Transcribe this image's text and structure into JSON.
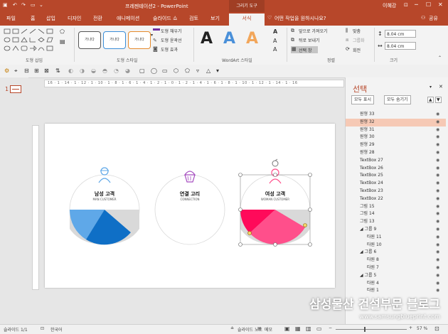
{
  "window": {
    "title": "프레젠테이션2 - PowerPoint",
    "contextual_tab_group": "그리기 도구",
    "user": "이혜강"
  },
  "tabs": [
    {
      "label": "파일"
    },
    {
      "label": "홈"
    },
    {
      "label": "삽입"
    },
    {
      "label": "디자인"
    },
    {
      "label": "전환"
    },
    {
      "label": "애니메이션"
    },
    {
      "label": "슬라이드 쇼"
    },
    {
      "label": "검토"
    },
    {
      "label": "보기"
    },
    {
      "label": "서식"
    }
  ],
  "tellme": {
    "placeholder": "어떤 작업을 원하시나요?"
  },
  "share_label": "공유",
  "ribbon": {
    "groups": {
      "shape_insert": "도형 삽입",
      "shape_styles": "도형 스타일",
      "wordart_styles": "WordArt 스타일",
      "arrange": "정렬",
      "size": "크기"
    },
    "style_presets": [
      "가나다",
      "가나다",
      "가나다"
    ],
    "shape_fill": "도형 채우기",
    "shape_outline": "도형 윤곽선",
    "shape_effects": "도형 효과",
    "wordart_samples": [
      "A",
      "A",
      "A"
    ],
    "bring_forward": "앞으로 가져오기",
    "send_backward": "뒤로 보내기",
    "selection_pane": "선택 창",
    "align": "맞춤",
    "group": "그룹화",
    "rotate": "회전",
    "height_value": "8.04 cm",
    "width_value": "8.04 cm"
  },
  "ruler_top_text": "16 · 1 · 14 · 1 · 12 · 1 · 10 · 1 · 8 · 1 · 6 · 1 · 4 · 1 · 2 · 1 · 0 · 1 · 2 · 1 · 4 · 1 · 6 · 1 · 8 · 1 · 10 · 1 · 12 · 1 · 14 · 1 · 16",
  "thumbnail": {
    "number": "1"
  },
  "slide": {
    "circles": [
      {
        "title": "남성 고객",
        "subtitle": "MAN CUSTOMER"
      },
      {
        "title": "연결 고리",
        "subtitle": "CONNECTION"
      },
      {
        "title": "여성 고객",
        "subtitle": "WOMAN CUSTOMER"
      }
    ]
  },
  "selection_pane": {
    "title": "선택",
    "show_all": "모두 표시",
    "hide_all": "모두 숨기기",
    "items": [
      {
        "name": "원형 33",
        "indent": 0,
        "selected": false
      },
      {
        "name": "원형 32",
        "indent": 0,
        "selected": true
      },
      {
        "name": "원형 31",
        "indent": 0,
        "selected": false
      },
      {
        "name": "원형 30",
        "indent": 0,
        "selected": false
      },
      {
        "name": "원형 29",
        "indent": 0,
        "selected": false
      },
      {
        "name": "원형 28",
        "indent": 0,
        "selected": false
      },
      {
        "name": "TextBox 27",
        "indent": 0,
        "selected": false
      },
      {
        "name": "TextBox 26",
        "indent": 0,
        "selected": false
      },
      {
        "name": "TextBox 25",
        "indent": 0,
        "selected": false
      },
      {
        "name": "TextBox 24",
        "indent": 0,
        "selected": false
      },
      {
        "name": "TextBox 23",
        "indent": 0,
        "selected": false
      },
      {
        "name": "TextBox 22",
        "indent": 0,
        "selected": false
      },
      {
        "name": "그림 15",
        "indent": 0,
        "selected": false
      },
      {
        "name": "그림 14",
        "indent": 0,
        "selected": false
      },
      {
        "name": "그림 13",
        "indent": 0,
        "selected": false
      },
      {
        "name": "◢ 그룹 9",
        "indent": 0,
        "selected": false
      },
      {
        "name": "타원 11",
        "indent": 1,
        "selected": false
      },
      {
        "name": "타원 10",
        "indent": 1,
        "selected": false
      },
      {
        "name": "◢ 그룹 6",
        "indent": 0,
        "selected": false
      },
      {
        "name": "타원 8",
        "indent": 1,
        "selected": false
      },
      {
        "name": "타원 7",
        "indent": 1,
        "selected": false
      },
      {
        "name": "◢ 그룹 5",
        "indent": 0,
        "selected": false
      },
      {
        "name": "타원 4",
        "indent": 1,
        "selected": false
      },
      {
        "name": "타원 1",
        "indent": 1,
        "selected": false
      }
    ]
  },
  "status": {
    "slide": "슬라이드 1/1",
    "language": "한국어",
    "notes": "슬라이드 노트",
    "comments": "메모",
    "zoom": "57 %"
  },
  "watermark": {
    "line1": "삼성물산 건설부문 블로그",
    "line2": "www.samsungblueprint.com"
  },
  "colors": {
    "accent": "#b7472a",
    "selection": "#f6c9b5",
    "blue_dark": "#0f6fc6",
    "blue_light": "#5fa8e8",
    "pink": "#ff4f8b",
    "pink_dark": "#ff0a5a",
    "gray": "#d9d9d9"
  }
}
